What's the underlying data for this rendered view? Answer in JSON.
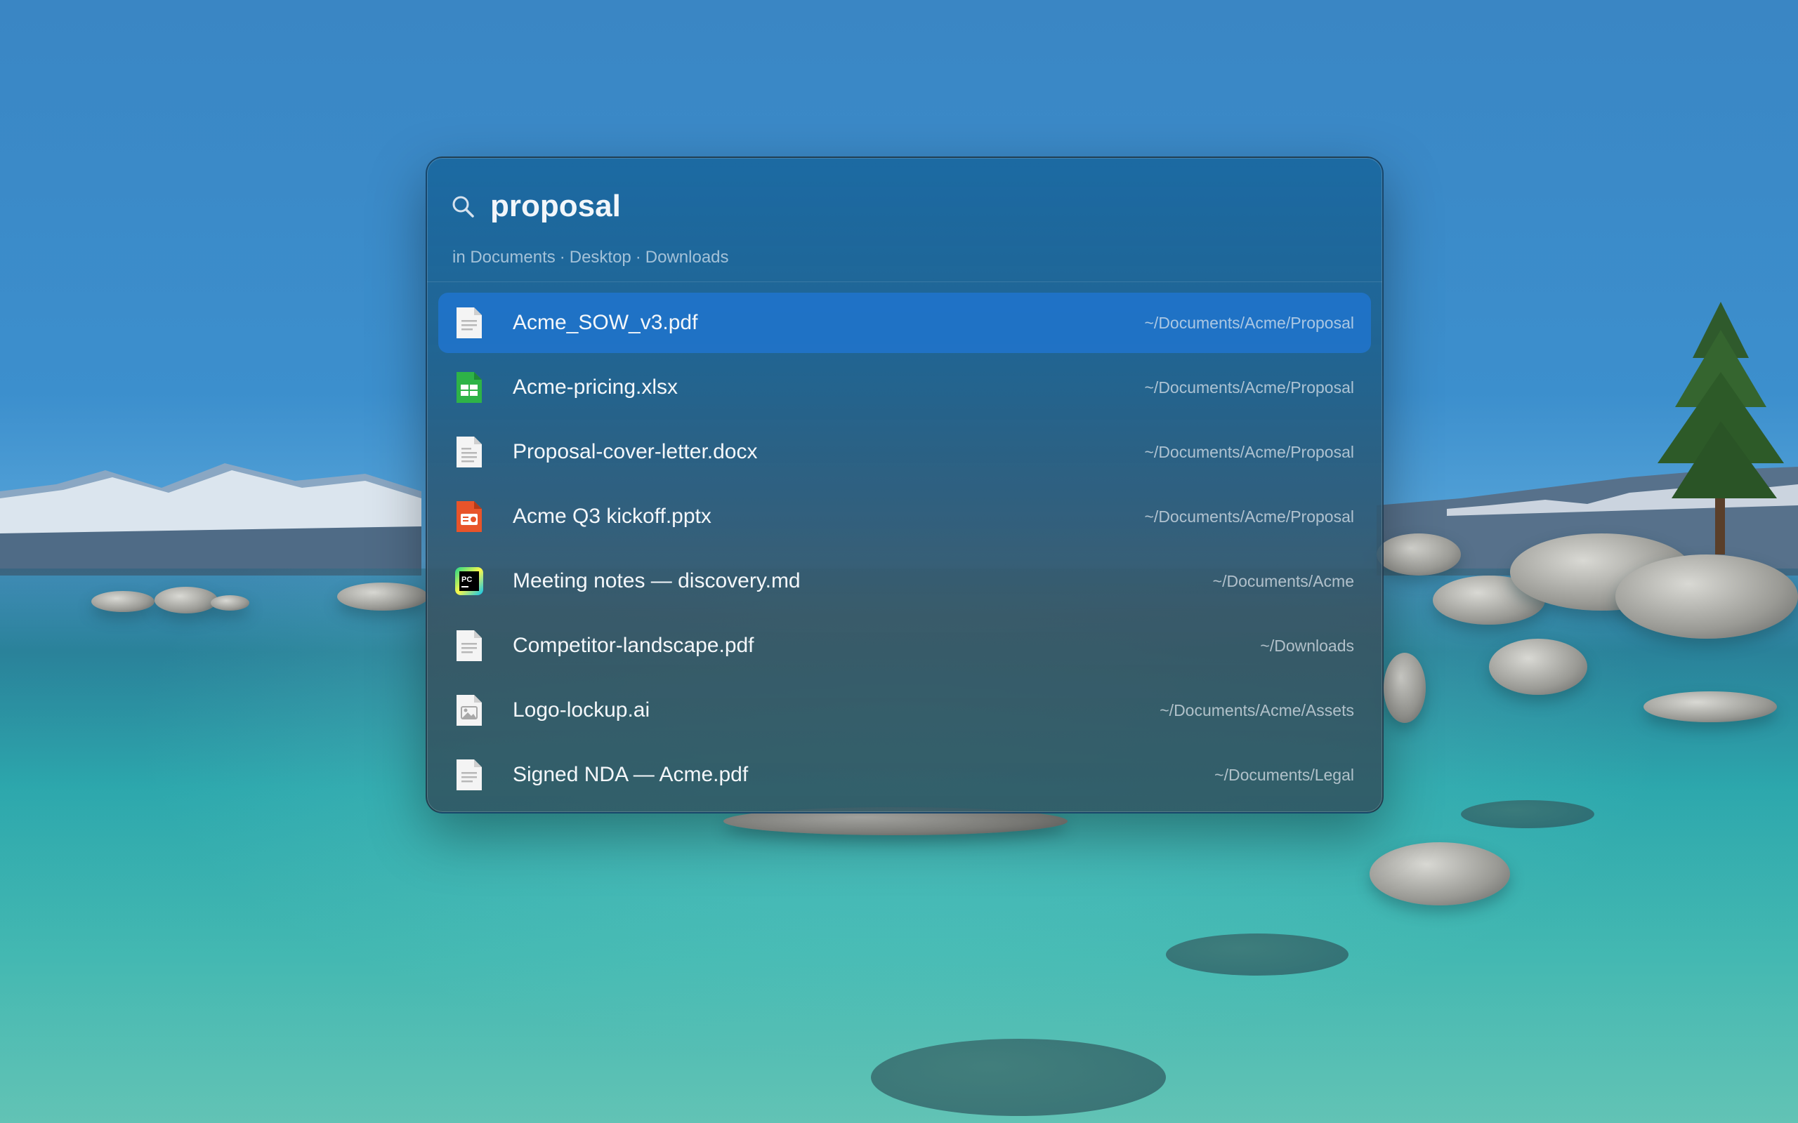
{
  "search": {
    "query": "proposal",
    "scope": [
      "in Documents",
      "Desktop",
      "Downloads"
    ],
    "scope_separator": "·"
  },
  "results": [
    {
      "name": "Acme_SOW_v3.pdf",
      "path": "~/Documents/Acme/Proposal",
      "icon": "pdf-file-icon",
      "selected": true
    },
    {
      "name": "Acme-pricing.xlsx",
      "path": "~/Documents/Acme/Proposal",
      "icon": "spreadsheet-file-icon",
      "selected": false
    },
    {
      "name": "Proposal-cover-letter.docx",
      "path": "~/Documents/Acme/Proposal",
      "icon": "document-file-icon",
      "selected": false
    },
    {
      "name": "Acme Q3 kickoff.pptx",
      "path": "~/Documents/Acme/Proposal",
      "icon": "presentation-file-icon",
      "selected": false
    },
    {
      "name": "Meeting notes — discovery.md",
      "path": "~/Documents/Acme",
      "icon": "pycharm-app-icon",
      "selected": false
    },
    {
      "name": "Competitor-landscape.pdf",
      "path": "~/Downloads",
      "icon": "pdf-file-icon",
      "selected": false
    },
    {
      "name": "Logo-lockup.ai",
      "path": "~/Documents/Acme/Assets",
      "icon": "image-file-icon",
      "selected": false
    },
    {
      "name": "Signed NDA — Acme.pdf",
      "path": "~/Documents/Legal",
      "icon": "pdf-file-icon",
      "selected": false
    }
  ],
  "icon_labels": {
    "pycharm": "PC"
  },
  "colors": {
    "selection": "#2074ce",
    "spreadsheet": "#2eb347",
    "presentation": "#e8542a"
  }
}
